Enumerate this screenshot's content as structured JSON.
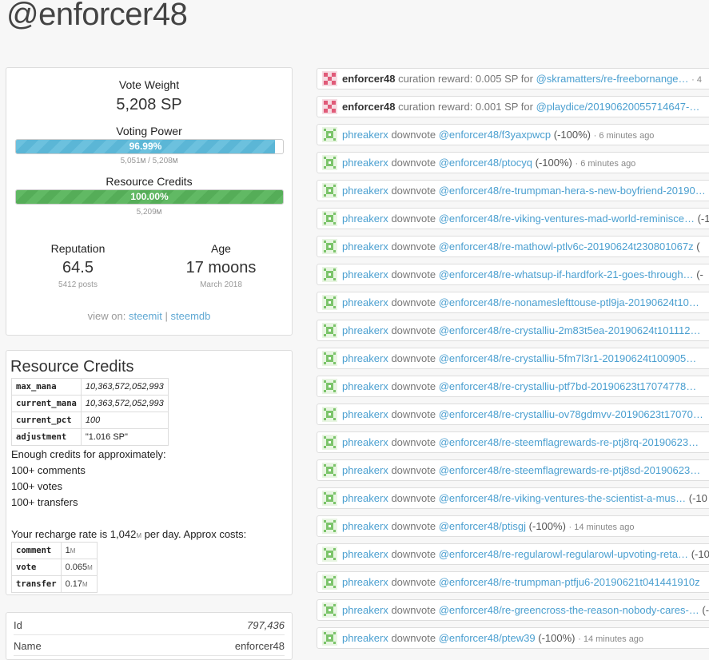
{
  "page": {
    "title": "@enforcer48"
  },
  "account": {
    "vote_weight_label": "Vote Weight",
    "vote_weight_value": "5,208 SP",
    "voting_power_label": "Voting Power",
    "voting_power_text": "96.99%",
    "voting_power_fraction": 0.9699,
    "voting_power_sub": "5,051",
    "voting_power_sub_unit": "M",
    "voting_power_sub_total": " / 5,208",
    "voting_power_sub_total_unit": "M",
    "resource_credits_label": "Resource Credits",
    "resource_credits_text": "100.00%",
    "resource_credits_fraction": 1.0,
    "resource_credits_sub": "5,209",
    "resource_credits_sub_unit": "M",
    "reputation_label": "Reputation",
    "reputation_value": "64.5",
    "reputation_sub": "5412 posts",
    "age_label": "Age",
    "age_value": "17 moons",
    "age_sub": "March 2018",
    "view_on_label": "view on:",
    "view_on_steemit": "steemit",
    "view_on_sep": "|",
    "view_on_steemdb": "steemdb",
    "bar_blue": "#5bb6d6",
    "bar_green": "#55ad58"
  },
  "resource_credits": {
    "title": "Resource Credits",
    "table": [
      {
        "k": "max_mana",
        "v": "10,363,572,052,993"
      },
      {
        "k": "current_mana",
        "v": "10,363,572,052,993"
      },
      {
        "k": "current_pct",
        "v": "100"
      },
      {
        "k": "adjustment",
        "v": "\"1.016 SP\""
      }
    ],
    "enough_text": "Enough credits for approximately:",
    "comments": "100+ comments",
    "votes": "100+ votes",
    "transfers": "100+ transfers",
    "recharge_prefix": "Your recharge rate is 1,042",
    "recharge_unit": "M",
    "recharge_suffix": " per day. Approx costs:",
    "costs": [
      {
        "k": "comment",
        "v": "1",
        "u": "M"
      },
      {
        "k": "vote",
        "v": "0.065",
        "u": "M"
      },
      {
        "k": "transfer",
        "v": "0.17",
        "u": "M"
      }
    ]
  },
  "info": {
    "rows": [
      {
        "k": "Id",
        "v": "797,436"
      },
      {
        "k": "Name",
        "v": "enforcer48"
      }
    ]
  },
  "feed": [
    {
      "avatar": "pink-pattern-avatar",
      "user": "enforcer48",
      "action": "curation reward: 0.005 SP for",
      "perm": "@skramatters/re-freebornange…",
      "time": "· 4"
    },
    {
      "avatar": "pink-pattern-avatar",
      "user": "enforcer48",
      "action": "curation reward: 0.001 SP for",
      "perm": "@playdice/20190620055714647-…",
      "time": ""
    },
    {
      "avatar": "green-pattern-avatar",
      "user": "phreakerx",
      "action": "downvote",
      "perm": "@enforcer48/f3yaxpwcp",
      "extra": "(-100%)",
      "time": "· 6 minutes ago"
    },
    {
      "avatar": "green-pattern-avatar",
      "user": "phreakerx",
      "action": "downvote",
      "perm": "@enforcer48/ptocyq",
      "extra": "(-100%)",
      "time": "· 6 minutes ago"
    },
    {
      "avatar": "green-pattern-avatar",
      "user": "phreakerx",
      "action": "downvote",
      "perm": "@enforcer48/re-trumpman-hera-s-new-boyfriend-20190…",
      "extra": "",
      "time": ""
    },
    {
      "avatar": "green-pattern-avatar",
      "user": "phreakerx",
      "action": "downvote",
      "perm": "@enforcer48/re-viking-ventures-mad-world-reminisce…",
      "extra": "(-1",
      "time": ""
    },
    {
      "avatar": "green-pattern-avatar",
      "user": "phreakerx",
      "action": "downvote",
      "perm": "@enforcer48/re-mathowl-ptlv6c-20190624t230801067z",
      "extra": "(",
      "time": ""
    },
    {
      "avatar": "green-pattern-avatar",
      "user": "phreakerx",
      "action": "downvote",
      "perm": "@enforcer48/re-whatsup-if-hardfork-21-goes-through…",
      "extra": "(-",
      "time": ""
    },
    {
      "avatar": "green-pattern-avatar",
      "user": "phreakerx",
      "action": "downvote",
      "perm": "@enforcer48/re-nonameslefttouse-ptl9ja-20190624t10…",
      "extra": "",
      "time": ""
    },
    {
      "avatar": "green-pattern-avatar",
      "user": "phreakerx",
      "action": "downvote",
      "perm": "@enforcer48/re-crystalliu-2m83t5ea-20190624t101112…",
      "extra": "",
      "time": ""
    },
    {
      "avatar": "green-pattern-avatar",
      "user": "phreakerx",
      "action": "downvote",
      "perm": "@enforcer48/re-crystalliu-5fm7l3r1-20190624t100905…",
      "extra": "",
      "time": ""
    },
    {
      "avatar": "green-pattern-avatar",
      "user": "phreakerx",
      "action": "downvote",
      "perm": "@enforcer48/re-crystalliu-ptf7bd-20190623t17074778…",
      "extra": "",
      "time": ""
    },
    {
      "avatar": "green-pattern-avatar",
      "user": "phreakerx",
      "action": "downvote",
      "perm": "@enforcer48/re-crystalliu-ov78gdmvv-20190623t17070…",
      "extra": "",
      "time": ""
    },
    {
      "avatar": "green-pattern-avatar",
      "user": "phreakerx",
      "action": "downvote",
      "perm": "@enforcer48/re-steemflagrewards-re-ptj8rq-20190623…",
      "extra": "",
      "time": ""
    },
    {
      "avatar": "green-pattern-avatar",
      "user": "phreakerx",
      "action": "downvote",
      "perm": "@enforcer48/re-steemflagrewards-re-ptj8sd-20190623…",
      "extra": "",
      "time": ""
    },
    {
      "avatar": "green-pattern-avatar",
      "user": "phreakerx",
      "action": "downvote",
      "perm": "@enforcer48/re-viking-ventures-the-scientist-a-mus…",
      "extra": "(-10",
      "time": ""
    },
    {
      "avatar": "green-pattern-avatar",
      "user": "phreakerx",
      "action": "downvote",
      "perm": "@enforcer48/ptisgj",
      "extra": "(-100%)",
      "time": "· 14 minutes ago"
    },
    {
      "avatar": "green-pattern-avatar",
      "user": "phreakerx",
      "action": "downvote",
      "perm": "@enforcer48/re-regularowl-regularowl-upvoting-reta…",
      "extra": "(-10",
      "time": ""
    },
    {
      "avatar": "green-pattern-avatar",
      "user": "phreakerx",
      "action": "downvote",
      "perm": "@enforcer48/re-trumpman-ptfju6-20190621t041441910z",
      "extra": "",
      "time": ""
    },
    {
      "avatar": "green-pattern-avatar",
      "user": "phreakerx",
      "action": "downvote",
      "perm": "@enforcer48/re-greencross-the-reason-nobody-cares-…",
      "extra": "(-",
      "time": ""
    },
    {
      "avatar": "green-pattern-avatar",
      "user": "phreakerx",
      "action": "downvote",
      "perm": "@enforcer48/ptew39",
      "extra": "(-100%)",
      "time": "· 14 minutes ago"
    }
  ]
}
